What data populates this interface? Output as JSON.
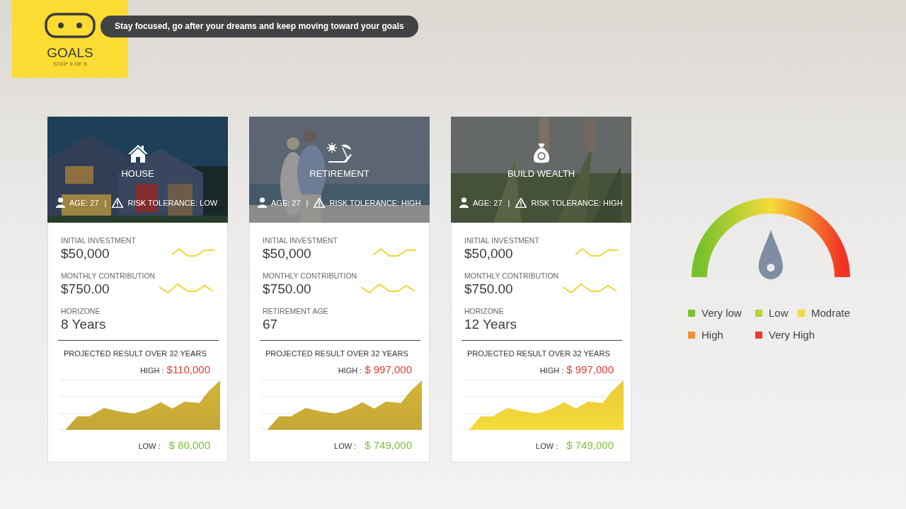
{
  "header": {
    "title": "GOALS",
    "step": "STEP 9 OF 9",
    "message": "Stay focused, go after your dreams and keep moving toward your goals"
  },
  "cards": [
    {
      "kind": "house",
      "title": "HOUSE",
      "age": "AGE: 27",
      "separator": "|",
      "risk": "RISK TOLERANCE: LOW",
      "fields": [
        {
          "label": "INITIAL INVESTMENT",
          "value": "$50,000"
        },
        {
          "label": "MONTHLY CONTRIBUTION",
          "value": "$750.00"
        },
        {
          "label": "HORIZONE",
          "value": "8 Years"
        }
      ],
      "projection": "PROJECTED RESULT OVER 32 YEARS",
      "high_label": "HIGH :",
      "high": "$110,000",
      "low_label": "LOW :",
      "low": "$ 80,000"
    },
    {
      "kind": "retirement",
      "title": "RETIREMENT",
      "age": "AGE: 27",
      "separator": "|",
      "risk": "RISK TOLERANCE: HIGH",
      "fields": [
        {
          "label": "INITIAL INVESTMENT",
          "value": "$50,000"
        },
        {
          "label": "MONTHLY CONTRIBUTION",
          "value": "$750.00"
        },
        {
          "label": "RETIREMENT AGE",
          "value": "67"
        }
      ],
      "projection": "PROJECTED RESULT OVER 32 YEARS",
      "high_label": "HIGH :",
      "high": "$ 997,000",
      "low_label": "LOW :",
      "low": "$ 749,000"
    },
    {
      "kind": "wealth",
      "title": "BUILD WEALTH",
      "age": "AGE: 27",
      "separator": "|",
      "risk": "RISK TOLERANCE: HIGH",
      "fields": [
        {
          "label": "INITIAL INVESTMENT",
          "value": "$50,000"
        },
        {
          "label": "MONTHLY CONTRIBUTION",
          "value": "$750.00"
        },
        {
          "label": "HORIZONE",
          "value": "12 Years"
        }
      ],
      "projection": "PROJECTED RESULT OVER 32 YEARS",
      "high_label": "HIGH :",
      "high": "$ 997,000",
      "low_label": "LOW :",
      "low": "$ 749,000"
    }
  ],
  "gauge": {
    "level": 0.5
  },
  "legend": [
    {
      "label": "Very low",
      "color": "#7dc12e"
    },
    {
      "label": "Low",
      "color": "#b5d334"
    },
    {
      "label": "Modrate",
      "color": "#f5d93a"
    },
    {
      "label": "High",
      "color": "#f29135"
    },
    {
      "label": "Very High",
      "color": "#ee3a26"
    }
  ]
}
